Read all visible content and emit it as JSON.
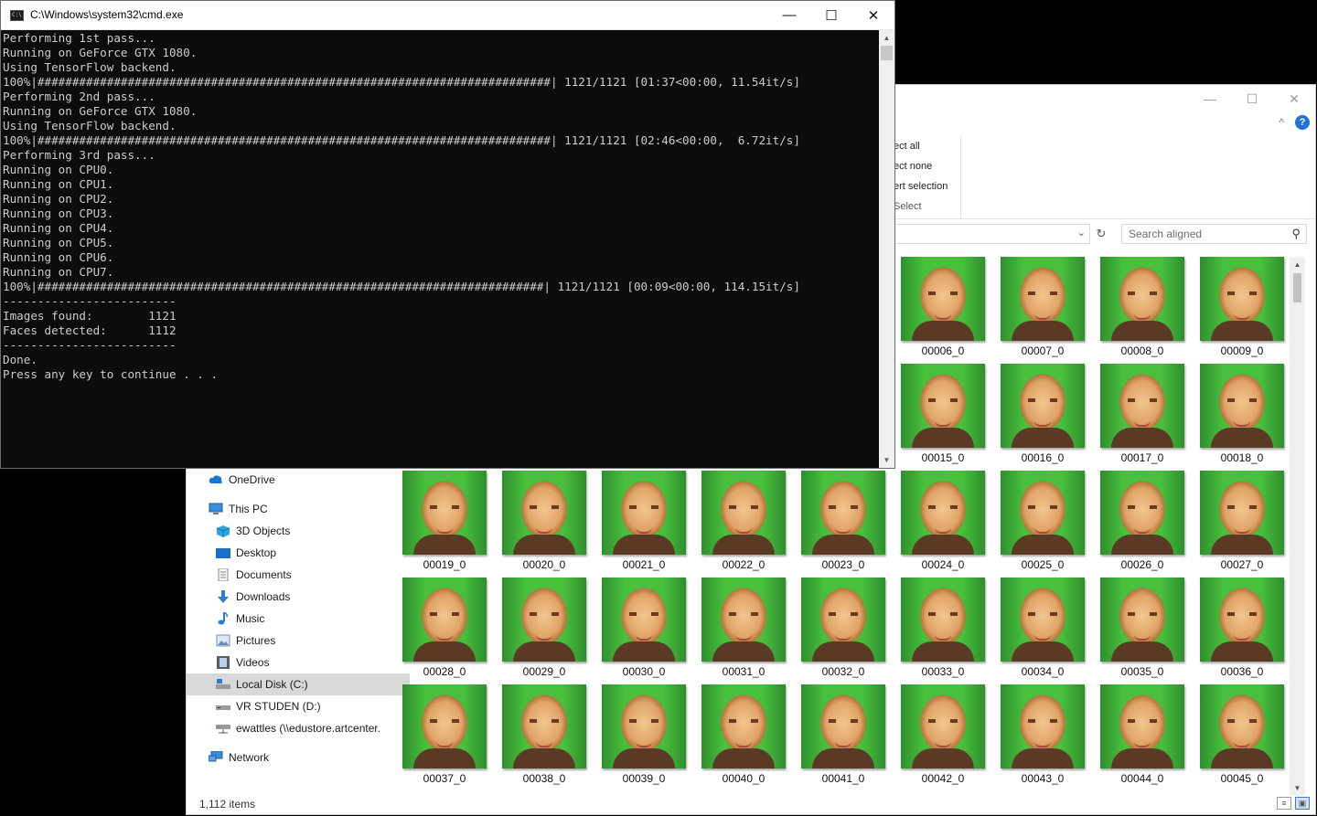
{
  "explorer": {
    "controls": {
      "minimize": "—",
      "maximize": "☐",
      "close": "✕"
    },
    "ribbon_expand": "^",
    "help": "?",
    "ribbon": [
      "ect all",
      "ect none",
      "ert selection",
      "Select"
    ],
    "address_chevron": "⌄",
    "refresh": "↻",
    "search": {
      "placeholder": "Search aligned",
      "icon": "search-icon"
    },
    "nav": [
      {
        "label": "OneDrive",
        "icon": "onedrive-cloud-icon"
      },
      {
        "label": "This PC",
        "icon": "this-pc-icon"
      },
      {
        "label": "3D Objects",
        "icon": "3d-objects-icon"
      },
      {
        "label": "Desktop",
        "icon": "desktop-folder-icon"
      },
      {
        "label": "Documents",
        "icon": "documents-icon"
      },
      {
        "label": "Downloads",
        "icon": "downloads-icon"
      },
      {
        "label": "Music",
        "icon": "music-icon"
      },
      {
        "label": "Pictures",
        "icon": "pictures-icon"
      },
      {
        "label": "Videos",
        "icon": "videos-icon"
      },
      {
        "label": "Local Disk (C:)",
        "icon": "local-disk-icon",
        "selected": true
      },
      {
        "label": "VR STUDEN (D:)",
        "icon": "drive-icon"
      },
      {
        "label": "ewattles (\\\\edustore.artcenter.",
        "icon": "network-drive-icon"
      },
      {
        "label": "Network",
        "icon": "network-icon"
      }
    ],
    "files_partial_rows": [
      [
        "00006_0",
        "00007_0",
        "00008_0",
        "00009_0"
      ],
      [
        "00015_0",
        "00016_0",
        "00017_0",
        "00018_0"
      ]
    ],
    "files_full_rows": [
      [
        "00019_0",
        "00020_0",
        "00021_0",
        "00022_0",
        "00023_0",
        "00024_0",
        "00025_0",
        "00026_0",
        "00027_0"
      ],
      [
        "00028_0",
        "00029_0",
        "00030_0",
        "00031_0",
        "00032_0",
        "00033_0",
        "00034_0",
        "00035_0",
        "00036_0"
      ],
      [
        "00037_0",
        "00038_0",
        "00039_0",
        "00040_0",
        "00041_0",
        "00042_0",
        "00043_0",
        "00044_0",
        "00045_0"
      ]
    ],
    "status": "1,112 items",
    "view_buttons": [
      "≡",
      "▣"
    ]
  },
  "cmd": {
    "title": "C:\\Windows\\system32\\cmd.exe",
    "icon_text": "C:\\",
    "controls": {
      "minimize": "—",
      "maximize": "☐",
      "close": "✕"
    },
    "lines": [
      "Performing 1st pass...",
      "Running on GeForce GTX 1080.",
      "Using TensorFlow backend.",
      "100%|##########################################################################| 1121/1121 [01:37<00:00, 11.54it/s]",
      "Performing 2nd pass...",
      "Running on GeForce GTX 1080.",
      "Using TensorFlow backend.",
      "100%|##########################################################################| 1121/1121 [02:46<00:00,  6.72it/s]",
      "Performing 3rd pass...",
      "Running on CPU0.",
      "Running on CPU1.",
      "Running on CPU2.",
      "Running on CPU3.",
      "Running on CPU4.",
      "Running on CPU5.",
      "Running on CPU6.",
      "Running on CPU7.",
      "100%|#########################################################################| 1121/1121 [00:09<00:00, 114.15it/s]",
      "-------------------------",
      "Images found:        1121",
      "Faces detected:      1112",
      "-------------------------",
      "Done.",
      "Press any key to continue . . ."
    ]
  }
}
